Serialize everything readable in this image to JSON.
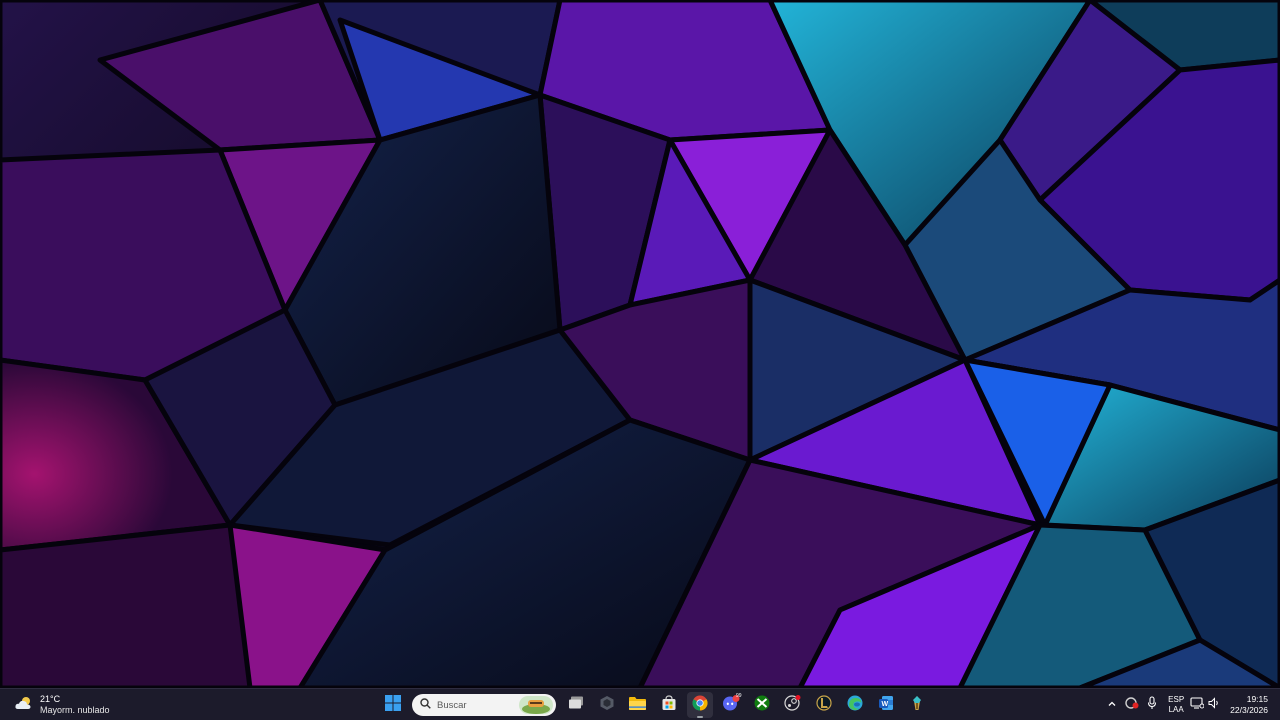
{
  "desktop": {
    "wallpaper": {
      "description_icon": "geometric-polygon-wallpaper",
      "colors": {
        "base": "#0a0618",
        "magenta": "#a0127a",
        "purple": "#6a18c8",
        "blue": "#1a4fd8",
        "cyan": "#1aa0c8",
        "dark": "#140a26"
      }
    }
  },
  "taskbar": {
    "background": "#1c1b2b",
    "weather": {
      "icon": "partly-cloudy-icon",
      "temperature": "21°C",
      "description": "Mayorm. nublado"
    },
    "start": {
      "icon": "windows-start-icon"
    },
    "search": {
      "icon": "search-icon",
      "placeholder": "Buscar"
    },
    "pinned_apps": [
      {
        "name": "task-view-icon"
      },
      {
        "name": "widget-app-icon"
      },
      {
        "name": "file-explorer-icon"
      },
      {
        "name": "microsoft-store-icon"
      },
      {
        "name": "chrome-icon",
        "active": true
      },
      {
        "name": "discord-icon",
        "badge": "99"
      },
      {
        "name": "xbox-icon"
      },
      {
        "name": "steam-icon"
      },
      {
        "name": "league-of-legends-icon"
      },
      {
        "name": "edge-icon"
      },
      {
        "name": "word-icon",
        "letter": "W"
      },
      {
        "name": "game-launcher-icon"
      }
    ],
    "tray": {
      "chevron_icon": "chevron-up-icon",
      "extra_icons": [
        "antivirus-tray-icon",
        "microphone-icon"
      ],
      "language": {
        "line1": "ESP",
        "line2": "LAA"
      },
      "system_icons": [
        "display-icon",
        "speaker-icon"
      ],
      "clock": {
        "time": "19:15",
        "date": "22/3/2026"
      }
    }
  }
}
